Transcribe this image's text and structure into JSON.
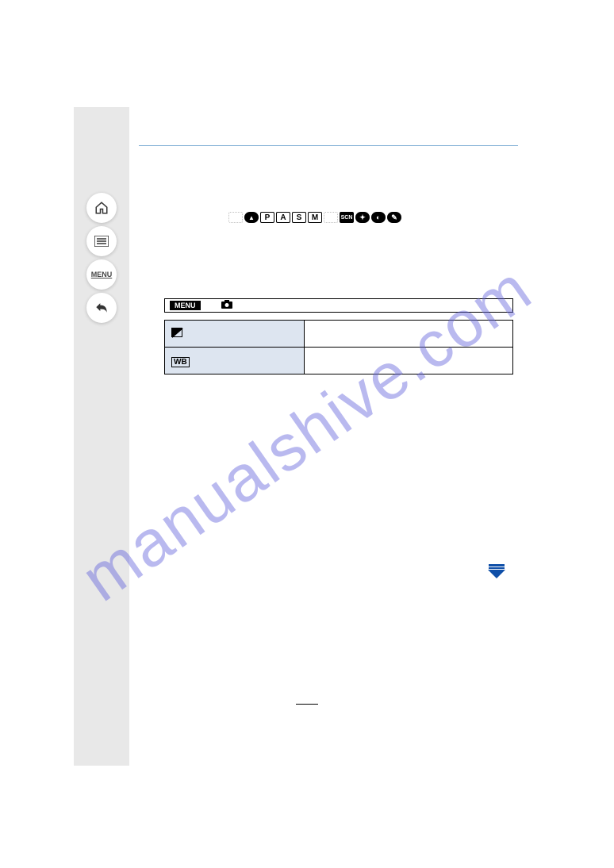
{
  "watermark": "manualshive.com",
  "nav": {
    "home": "home-icon",
    "toc": "toc-icon",
    "menu_label": "MENU",
    "back": "back-icon"
  },
  "modes": [
    "iA",
    "P",
    "A",
    "S",
    "M",
    "",
    "SCN",
    "",
    "",
    ""
  ],
  "menu": {
    "label": "MENU",
    "section_icon": "camera-icon"
  },
  "table": {
    "rows": [
      {
        "icon": "ev-icon",
        "label": "",
        "value": ""
      },
      {
        "icon": "wb-icon",
        "label": "WB",
        "value": ""
      }
    ]
  },
  "page_number": ""
}
